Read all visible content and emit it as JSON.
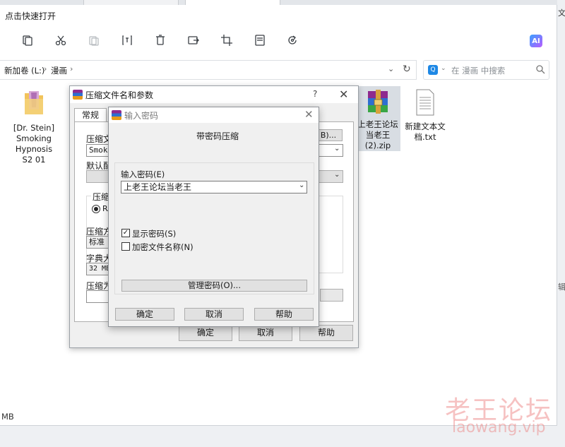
{
  "explorer": {
    "quick_access": "点击快速打开",
    "toolbar": {
      "buttons": [
        "copy-icon",
        "cut-icon",
        "paste-icon",
        "rename-icon",
        "delete-icon",
        "share-icon",
        "crop-icon",
        "save-icon",
        "rotate-icon"
      ],
      "ai_label": "AI"
    },
    "breadcrumb": [
      "新加卷 (L:)",
      "漫画"
    ],
    "search_placeholder": "在 漫画 中搜索",
    "files": [
      {
        "name": "[Dr. Stein] Smoking Hypnosis S2 01",
        "type": "folder"
      },
      {
        "name": "上老王论坛当老王 (2).zip",
        "type": "zip"
      },
      {
        "name": "新建文本文档.txt",
        "type": "text"
      }
    ],
    "status_size": "MB",
    "right_edge_1": "文",
    "right_edge_2": "辑"
  },
  "archive_dialog": {
    "title": "压缩文件名和参数",
    "help": "?",
    "tab_general": "常规",
    "archive_name_label": "压缩文",
    "archive_name_value": "Smoki",
    "browse_button": "B)...",
    "default_profile_label": "默认配",
    "format_label": "压缩",
    "format_option": "RA",
    "method_label": "压缩方",
    "method_value": "标准",
    "dict_label": "字典大",
    "dict_value": "32 MB",
    "split_label": "压缩为",
    "ok": "确定",
    "cancel": "取消",
    "help_button": "帮助"
  },
  "password_dialog": {
    "title": "输入密码",
    "heading": "带密码压缩",
    "enter_password_label": "输入密码(E)",
    "password_value": "上老王论坛当老王",
    "show_password": "显示密码(S)",
    "show_password_checked": true,
    "encrypt_names": "加密文件名称(N)",
    "encrypt_names_checked": false,
    "manage_button": "管理密码(O)...",
    "ok": "确定",
    "cancel": "取消",
    "help": "帮助"
  },
  "watermark": {
    "cn": "老王论坛",
    "en": "laowang.vip"
  }
}
